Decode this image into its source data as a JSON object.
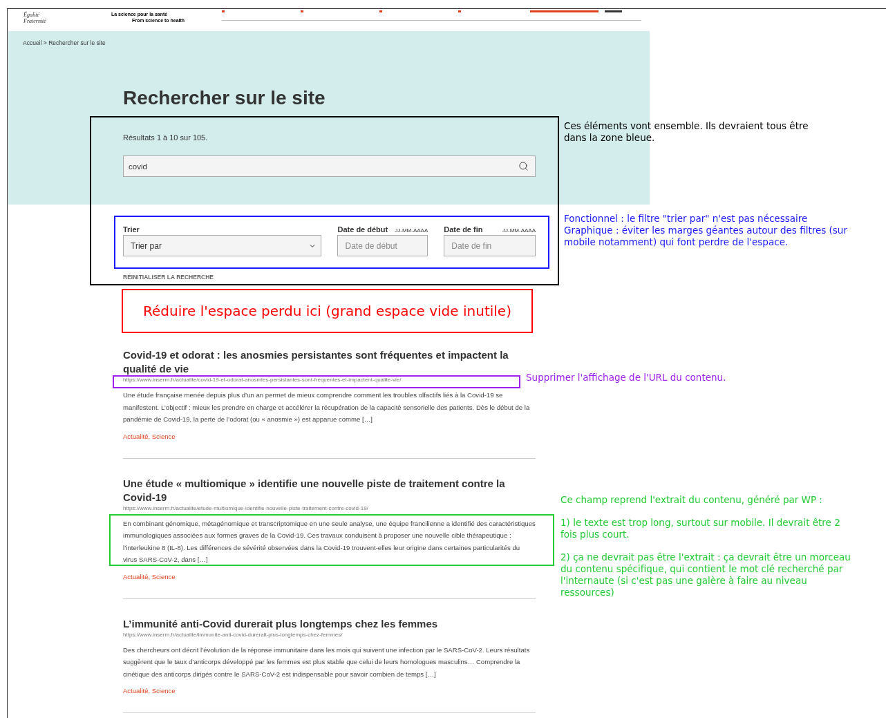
{
  "header": {
    "motto": [
      "Égalité",
      "Fraternité"
    ],
    "tagline": "La science pour la santé",
    "tagline_en": "From science to health"
  },
  "breadcrumb": {
    "items": [
      "Accueil",
      "Rechercher sur le site"
    ],
    "separator": ">"
  },
  "title": "Rechercher sur le site",
  "results_count": "Résultats 1 à 10 sur 105.",
  "search": {
    "value": "covid"
  },
  "filters": [
    {
      "kind": "select",
      "label": "Trier",
      "value": "Trier par"
    },
    {
      "kind": "date",
      "label": "Date de début",
      "hint": "JJ-MM-AAAA",
      "placeholder": "Date de début"
    },
    {
      "kind": "date",
      "label": "Date de fin",
      "hint": "JJ-MM-AAAA",
      "placeholder": "Date de fin"
    }
  ],
  "reset_link": "RÉINITIALISER LA RECHERCHE",
  "results": [
    {
      "title": "Covid-19 et odorat : les anosmies persistantes sont fréquentes et impactent la qualité de vie",
      "url": "https://www.inserm.fr/actualite/covid-19-et-odorat-anosmies-persistantes-sont-frequentes-et-impactent-qualite-vie/",
      "excerpt": "Une étude française menée depuis plus d’un an permet de mieux comprendre comment les troubles olfactifs liés à la Covid-19 se manifestent. L’objectif : mieux les prendre en charge et accélérer la récupération de la capacité sensorielle des patients. Dès le début de la pandémie de Covid-19, la perte de l’odorat (ou « anosmie ») est apparue comme […]",
      "categories": "Actualité, Science"
    },
    {
      "title": "Une étude « multiomique » identifie une nouvelle piste de traitement contre la Covid-19",
      "url": "https://www.inserm.fr/actualite/etude-multiomique-identifie-nouvelle-piste-traitement-contre-covid-19/",
      "excerpt": "En combinant génomique, métagénomique et transcriptomique en une seule analyse, une équipe francilienne a identifié des caractéristiques immunologiques associées aux formes graves de la Covid-19. Ces travaux conduisent à proposer une nouvelle cible thérapeutique : l’interleukine 8 (IL-8). Les différences de sévérité observées dans la Covid-19 trouvent-elles leur origine dans certaines particularités du virus SARS-CoV-2, dans […]",
      "categories": "Actualité, Science"
    },
    {
      "title": "L’immunité anti-Covid durerait plus longtemps chez les femmes",
      "url": "https://www.inserm.fr/actualite/immunite-anti-covid-durerait-plus-longtemps-chez-femmes/",
      "excerpt": "Des chercheurs ont décrit l’évolution de la réponse immunitaire dans les mois qui suivent une infection par le SARS-CoV-2. Leurs résultats suggèrent que le taux d’anticorps développé par les femmes est plus stable que celui de leurs homologues masculins… Comprendre la cinétique des anticorps dirigés contre le SARS-CoV-2 est indispensable pour savoir combien de temps […]",
      "categories": "Actualité, Science"
    }
  ],
  "annotations": [
    {
      "kind": "outline",
      "color": "#000000",
      "notes": [
        "Ces éléments vont ensemble. Ils devraient tous être dans la zone bleue."
      ]
    },
    {
      "kind": "outline",
      "color": "#1a1aff",
      "notes": [
        "Fonctionnel : le filtre \"trier par\" n'est pas nécessaire",
        "Graphique : éviter les marges géantes autour des filtres (sur mobile notamment) qui font perdre de l'espace."
      ]
    },
    {
      "kind": "labeled",
      "color": "#ff0000",
      "notes": [
        "Réduire l'espace perdu ici (grand espace vide inutile)"
      ]
    },
    {
      "kind": "outline",
      "color": "#a020f0",
      "notes": [
        "Supprimer l'affichage de l'URL du contenu."
      ]
    },
    {
      "kind": "outline",
      "color": "#22cc33",
      "notes": [
        "Ce champ reprend l'extrait du contenu, généré par WP  :",
        "1) le texte est trop long, surtout sur mobile. Il devrait être 2 fois plus court.",
        "2) ça ne devrait pas être l'extrait : ça devrait être un morceau du contenu spécifique, qui contient le mot clé recherché par l'internaute (si c'est pas une galère à faire au niveau ressources)"
      ]
    }
  ]
}
